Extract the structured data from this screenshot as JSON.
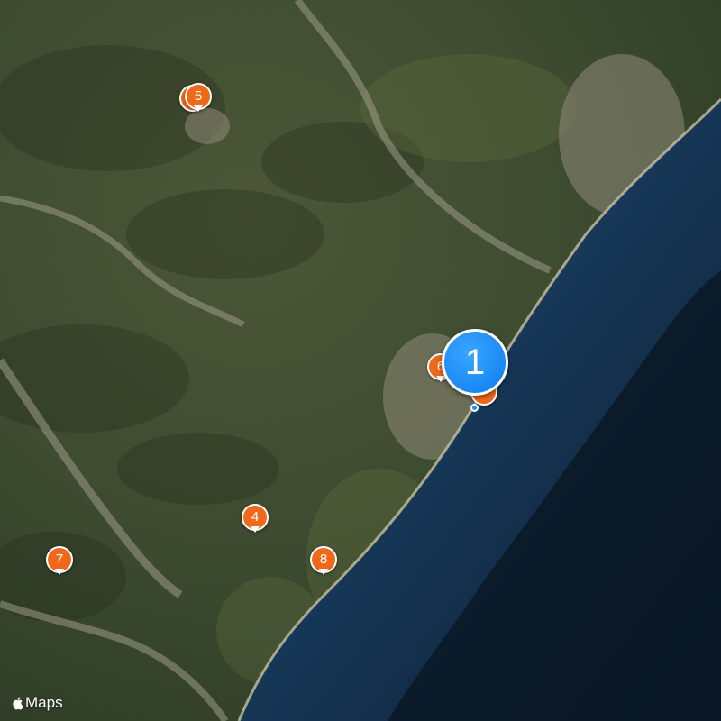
{
  "map": {
    "cluster": {
      "count": "1",
      "color": "#1d8cff"
    },
    "pins": [
      {
        "label": "5",
        "id": "5"
      },
      {
        "label": "6",
        "id": "6"
      },
      {
        "label": "4",
        "id": "4"
      },
      {
        "label": "7",
        "id": "7"
      },
      {
        "label": "8",
        "id": "8"
      }
    ],
    "pin_color": "#f0691a",
    "attribution": {
      "icon": "apple-icon",
      "text": "Maps"
    }
  }
}
